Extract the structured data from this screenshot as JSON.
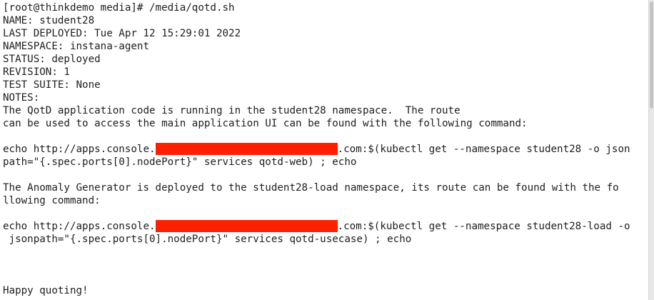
{
  "colors": {
    "background": "#ffffff",
    "text": "#1e1e1e",
    "redaction": "#ff2000"
  },
  "terminal": {
    "prompt_line": "[root@thinkdemo media]# /media/qotd.sh",
    "name": "NAME: student28",
    "last_deployed": "LAST DEPLOYED: Tue Apr 12 15:29:01 2022",
    "namespace": "NAMESPACE: instana-agent",
    "status": "STATUS: deployed",
    "revision": "REVISION: 1",
    "test_suite": "TEST SUITE: None",
    "notes_header": "NOTES:",
    "notes_1": "The QotD application code is running in the student28 namespace.  The route",
    "notes_2": "can be used to access the main application UI can be found with the following command:",
    "cmd1_prefix": "echo http://apps.console.",
    "cmd1_suffix": ".com:$(kubectl get --namespace student28 -o json",
    "cmd1_cont": "path=\"{.spec.ports[0].nodePort}\" services qotd-web) ; echo",
    "anomaly_1": "The Anomaly Generator is deployed to the student28-load namespace, its route can be found with the fo",
    "anomaly_2": "llowing command:",
    "cmd2_prefix": "echo http://apps.console.",
    "cmd2_suffix": ".com:$(kubectl get --namespace student28-load -o",
    "cmd2_cont": " jsonpath=\"{.spec.ports[0].nodePort}\" services qotd-usecase) ; echo",
    "closing": "Happy quoting!"
  }
}
